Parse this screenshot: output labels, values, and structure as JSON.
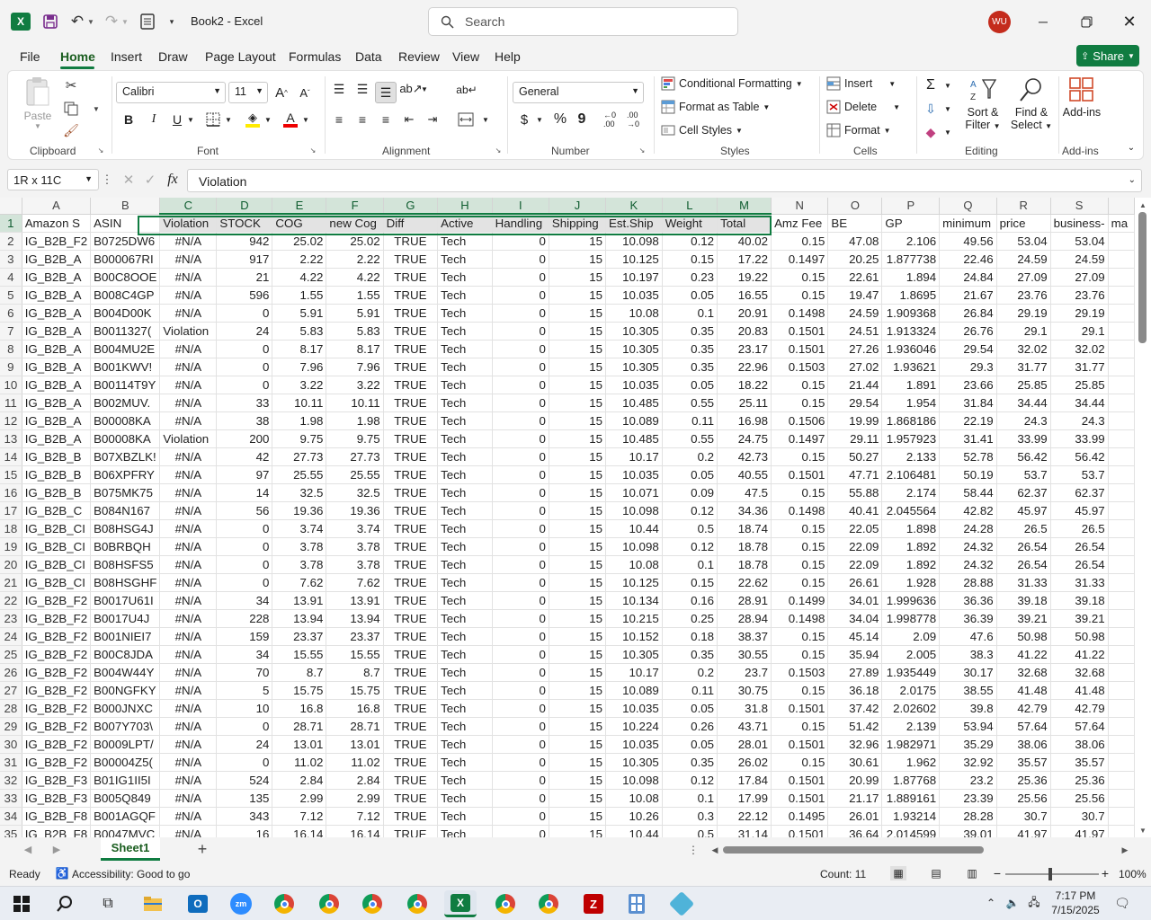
{
  "app": {
    "title": "Book2 - Excel",
    "search_placeholder": "Search",
    "user_initials": "WU"
  },
  "tabs": [
    "File",
    "Home",
    "Insert",
    "Draw",
    "Page Layout",
    "Formulas",
    "Data",
    "Review",
    "View",
    "Help"
  ],
  "share_label": "Share",
  "ribbon": {
    "clipboard": {
      "label": "Clipboard",
      "paste": "Paste"
    },
    "font": {
      "label": "Font",
      "name": "Calibri",
      "size": "11"
    },
    "alignment": {
      "label": "Alignment"
    },
    "number": {
      "label": "Number",
      "format": "General"
    },
    "styles": {
      "label": "Styles",
      "conditional": "Conditional Formatting",
      "format_table": "Format as Table",
      "cell_styles": "Cell Styles"
    },
    "cells": {
      "label": "Cells",
      "insert": "Insert",
      "delete": "Delete",
      "format": "Format"
    },
    "editing": {
      "label": "Editing",
      "sort": "Sort &",
      "filter": "Filter",
      "find": "Find &",
      "select": "Select"
    },
    "addins": {
      "label": "Add-ins",
      "addins": "Add-ins"
    }
  },
  "formula_bar": {
    "name_box": "1R x 11C",
    "value": "Violation"
  },
  "columns": [
    "A",
    "B",
    "C",
    "D",
    "E",
    "F",
    "G",
    "H",
    "I",
    "J",
    "K",
    "L",
    "M",
    "N",
    "O",
    "P",
    "Q",
    "R",
    "S",
    ""
  ],
  "header_row": [
    "Amazon S",
    "ASIN",
    "Violation",
    "STOCK",
    "COG",
    "new Cog",
    "Diff",
    "Active",
    "Handling",
    "Shipping",
    "Est.Ship",
    "Weight",
    "Total",
    "Amz Fee",
    "BE",
    "GP",
    "minimum",
    "price",
    "business-",
    "ma"
  ],
  "rows": [
    [
      "IG_B2B_F2",
      "B0725DW6",
      "#N/A",
      "942",
      "25.02",
      "25.02",
      "TRUE",
      "Tech",
      "0",
      "15",
      "10.098",
      "0.12",
      "40.02",
      "0.15",
      "47.08",
      "2.106",
      "49.56",
      "53.04",
      "53.04"
    ],
    [
      "IG_B2B_A",
      "B000067RI",
      "#N/A",
      "917",
      "2.22",
      "2.22",
      "TRUE",
      "Tech",
      "0",
      "15",
      "10.125",
      "0.15",
      "17.22",
      "0.1497",
      "20.25",
      "1.877738",
      "22.46",
      "24.59",
      "24.59"
    ],
    [
      "IG_B2B_A",
      "B00C8OOE",
      "#N/A",
      "21",
      "4.22",
      "4.22",
      "TRUE",
      "Tech",
      "0",
      "15",
      "10.197",
      "0.23",
      "19.22",
      "0.15",
      "22.61",
      "1.894",
      "24.84",
      "27.09",
      "27.09"
    ],
    [
      "IG_B2B_A",
      "B008C4GP",
      "#N/A",
      "596",
      "1.55",
      "1.55",
      "TRUE",
      "Tech",
      "0",
      "15",
      "10.035",
      "0.05",
      "16.55",
      "0.15",
      "19.47",
      "1.8695",
      "21.67",
      "23.76",
      "23.76"
    ],
    [
      "IG_B2B_A",
      "B004D00K",
      "#N/A",
      "0",
      "5.91",
      "5.91",
      "TRUE",
      "Tech",
      "0",
      "15",
      "10.08",
      "0.1",
      "20.91",
      "0.1498",
      "24.59",
      "1.909368",
      "26.84",
      "29.19",
      "29.19"
    ],
    [
      "IG_B2B_A",
      "B0011327(",
      "Violation",
      "24",
      "5.83",
      "5.83",
      "TRUE",
      "Tech",
      "0",
      "15",
      "10.305",
      "0.35",
      "20.83",
      "0.1501",
      "24.51",
      "1.913324",
      "26.76",
      "29.1",
      "29.1"
    ],
    [
      "IG_B2B_A",
      "B004MU2E",
      "#N/A",
      "0",
      "8.17",
      "8.17",
      "TRUE",
      "Tech",
      "0",
      "15",
      "10.305",
      "0.35",
      "23.17",
      "0.1501",
      "27.26",
      "1.936046",
      "29.54",
      "32.02",
      "32.02"
    ],
    [
      "IG_B2B_A",
      "B001KWV!",
      "#N/A",
      "0",
      "7.96",
      "7.96",
      "TRUE",
      "Tech",
      "0",
      "15",
      "10.305",
      "0.35",
      "22.96",
      "0.1503",
      "27.02",
      "1.93621",
      "29.3",
      "31.77",
      "31.77"
    ],
    [
      "IG_B2B_A",
      "B00114T9Y",
      "#N/A",
      "0",
      "3.22",
      "3.22",
      "TRUE",
      "Tech",
      "0",
      "15",
      "10.035",
      "0.05",
      "18.22",
      "0.15",
      "21.44",
      "1.891",
      "23.66",
      "25.85",
      "25.85"
    ],
    [
      "IG_B2B_A",
      "B002MUV.",
      "#N/A",
      "33",
      "10.11",
      "10.11",
      "TRUE",
      "Tech",
      "0",
      "15",
      "10.485",
      "0.55",
      "25.11",
      "0.15",
      "29.54",
      "1.954",
      "31.84",
      "34.44",
      "34.44"
    ],
    [
      "IG_B2B_A",
      "B00008KA",
      "#N/A",
      "38",
      "1.98",
      "1.98",
      "TRUE",
      "Tech",
      "0",
      "15",
      "10.089",
      "0.11",
      "16.98",
      "0.1506",
      "19.99",
      "1.868186",
      "22.19",
      "24.3",
      "24.3"
    ],
    [
      "IG_B2B_A",
      "B00008KA",
      "Violation",
      "200",
      "9.75",
      "9.75",
      "TRUE",
      "Tech",
      "0",
      "15",
      "10.485",
      "0.55",
      "24.75",
      "0.1497",
      "29.11",
      "1.957923",
      "31.41",
      "33.99",
      "33.99"
    ],
    [
      "IG_B2B_B",
      "B07XBZLK!",
      "#N/A",
      "42",
      "27.73",
      "27.73",
      "TRUE",
      "Tech",
      "0",
      "15",
      "10.17",
      "0.2",
      "42.73",
      "0.15",
      "50.27",
      "2.133",
      "52.78",
      "56.42",
      "56.42"
    ],
    [
      "IG_B2B_B",
      "B06XPFRY",
      "#N/A",
      "97",
      "25.55",
      "25.55",
      "TRUE",
      "Tech",
      "0",
      "15",
      "10.035",
      "0.05",
      "40.55",
      "0.1501",
      "47.71",
      "2.106481",
      "50.19",
      "53.7",
      "53.7"
    ],
    [
      "IG_B2B_B",
      "B075MK75",
      "#N/A",
      "14",
      "32.5",
      "32.5",
      "TRUE",
      "Tech",
      "0",
      "15",
      "10.071",
      "0.09",
      "47.5",
      "0.15",
      "55.88",
      "2.174",
      "58.44",
      "62.37",
      "62.37"
    ],
    [
      "IG_B2B_C",
      "B084N167",
      "#N/A",
      "56",
      "19.36",
      "19.36",
      "TRUE",
      "Tech",
      "0",
      "15",
      "10.098",
      "0.12",
      "34.36",
      "0.1498",
      "40.41",
      "2.045564",
      "42.82",
      "45.97",
      "45.97"
    ],
    [
      "IG_B2B_CI",
      "B08HSG4J",
      "#N/A",
      "0",
      "3.74",
      "3.74",
      "TRUE",
      "Tech",
      "0",
      "15",
      "10.44",
      "0.5",
      "18.74",
      "0.15",
      "22.05",
      "1.898",
      "24.28",
      "26.5",
      "26.5"
    ],
    [
      "IG_B2B_CI",
      "B0BRBQH",
      "#N/A",
      "0",
      "3.78",
      "3.78",
      "TRUE",
      "Tech",
      "0",
      "15",
      "10.098",
      "0.12",
      "18.78",
      "0.15",
      "22.09",
      "1.892",
      "24.32",
      "26.54",
      "26.54"
    ],
    [
      "IG_B2B_CI",
      "B08HSFS5",
      "#N/A",
      "0",
      "3.78",
      "3.78",
      "TRUE",
      "Tech",
      "0",
      "15",
      "10.08",
      "0.1",
      "18.78",
      "0.15",
      "22.09",
      "1.892",
      "24.32",
      "26.54",
      "26.54"
    ],
    [
      "IG_B2B_CI",
      "B08HSGHF",
      "#N/A",
      "0",
      "7.62",
      "7.62",
      "TRUE",
      "Tech",
      "0",
      "15",
      "10.125",
      "0.15",
      "22.62",
      "0.15",
      "26.61",
      "1.928",
      "28.88",
      "31.33",
      "31.33"
    ],
    [
      "IG_B2B_F2",
      "B0017U61I",
      "#N/A",
      "34",
      "13.91",
      "13.91",
      "TRUE",
      "Tech",
      "0",
      "15",
      "10.134",
      "0.16",
      "28.91",
      "0.1499",
      "34.01",
      "1.999636",
      "36.36",
      "39.18",
      "39.18"
    ],
    [
      "IG_B2B_F2",
      "B0017U4J",
      "#N/A",
      "228",
      "13.94",
      "13.94",
      "TRUE",
      "Tech",
      "0",
      "15",
      "10.215",
      "0.25",
      "28.94",
      "0.1498",
      "34.04",
      "1.998778",
      "36.39",
      "39.21",
      "39.21"
    ],
    [
      "IG_B2B_F2",
      "B001NIEI7",
      "#N/A",
      "159",
      "23.37",
      "23.37",
      "TRUE",
      "Tech",
      "0",
      "15",
      "10.152",
      "0.18",
      "38.37",
      "0.15",
      "45.14",
      "2.09",
      "47.6",
      "50.98",
      "50.98"
    ],
    [
      "IG_B2B_F2",
      "B00C8JDA",
      "#N/A",
      "34",
      "15.55",
      "15.55",
      "TRUE",
      "Tech",
      "0",
      "15",
      "10.305",
      "0.35",
      "30.55",
      "0.15",
      "35.94",
      "2.005",
      "38.3",
      "41.22",
      "41.22"
    ],
    [
      "IG_B2B_F2",
      "B004W44Y",
      "#N/A",
      "70",
      "8.7",
      "8.7",
      "TRUE",
      "Tech",
      "0",
      "15",
      "10.17",
      "0.2",
      "23.7",
      "0.1503",
      "27.89",
      "1.935449",
      "30.17",
      "32.68",
      "32.68"
    ],
    [
      "IG_B2B_F2",
      "B00NGFKY",
      "#N/A",
      "5",
      "15.75",
      "15.75",
      "TRUE",
      "Tech",
      "0",
      "15",
      "10.089",
      "0.11",
      "30.75",
      "0.15",
      "36.18",
      "2.0175",
      "38.55",
      "41.48",
      "41.48"
    ],
    [
      "IG_B2B_F2",
      "B000JNXC",
      "#N/A",
      "10",
      "16.8",
      "16.8",
      "TRUE",
      "Tech",
      "0",
      "15",
      "10.035",
      "0.05",
      "31.8",
      "0.1501",
      "37.42",
      "2.02602",
      "39.8",
      "42.79",
      "42.79"
    ],
    [
      "IG_B2B_F2",
      "B007Y703\\",
      "#N/A",
      "0",
      "28.71",
      "28.71",
      "TRUE",
      "Tech",
      "0",
      "15",
      "10.224",
      "0.26",
      "43.71",
      "0.15",
      "51.42",
      "2.139",
      "53.94",
      "57.64",
      "57.64"
    ],
    [
      "IG_B2B_F2",
      "B0009LPT/",
      "#N/A",
      "24",
      "13.01",
      "13.01",
      "TRUE",
      "Tech",
      "0",
      "15",
      "10.035",
      "0.05",
      "28.01",
      "0.1501",
      "32.96",
      "1.982971",
      "35.29",
      "38.06",
      "38.06"
    ],
    [
      "IG_B2B_F2",
      "B00004Z5(",
      "#N/A",
      "0",
      "11.02",
      "11.02",
      "TRUE",
      "Tech",
      "0",
      "15",
      "10.305",
      "0.35",
      "26.02",
      "0.15",
      "30.61",
      "1.962",
      "32.92",
      "35.57",
      "35.57"
    ],
    [
      "IG_B2B_F3",
      "B01IG1II5I",
      "#N/A",
      "524",
      "2.84",
      "2.84",
      "TRUE",
      "Tech",
      "0",
      "15",
      "10.098",
      "0.12",
      "17.84",
      "0.1501",
      "20.99",
      "1.87768",
      "23.2",
      "25.36",
      "25.36"
    ],
    [
      "IG_B2B_F3",
      "B005Q849",
      "#N/A",
      "135",
      "2.99",
      "2.99",
      "TRUE",
      "Tech",
      "0",
      "15",
      "10.08",
      "0.1",
      "17.99",
      "0.1501",
      "21.17",
      "1.889161",
      "23.39",
      "25.56",
      "25.56"
    ],
    [
      "IG_B2B_F8",
      "B001AGQF",
      "#N/A",
      "343",
      "7.12",
      "7.12",
      "TRUE",
      "Tech",
      "0",
      "15",
      "10.26",
      "0.3",
      "22.12",
      "0.1495",
      "26.01",
      "1.93214",
      "28.28",
      "30.7",
      "30.7"
    ],
    [
      "IG_B2B_F8",
      "B0047MVC",
      "#N/A",
      "16",
      "16.14",
      "16.14",
      "TRUE",
      "Tech",
      "0",
      "15",
      "10.44",
      "0.5",
      "31.14",
      "0.1501",
      "36.64",
      "2.014599",
      "39.01",
      "41.97",
      "41.97"
    ]
  ],
  "sheet_tab": "Sheet1",
  "status": {
    "ready": "Ready",
    "accessibility": "Accessibility: Good to go",
    "count": "Count: 11",
    "zoom": "100%"
  },
  "taskbar": {
    "time": "7:17 PM",
    "date": "7/15/2025"
  },
  "colors": {
    "excel_green": "#107c41",
    "selection_fill": "#d3e4d9",
    "avatar": "#c42b1c"
  }
}
